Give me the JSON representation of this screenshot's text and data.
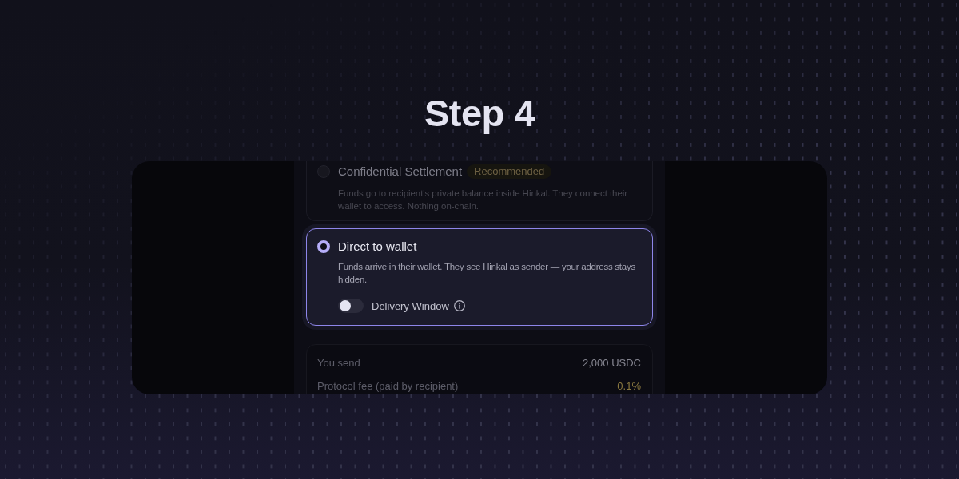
{
  "heading": "Step 4",
  "delivery_options": [
    {
      "title": "Confidential Settlement",
      "badge": "Recommended",
      "description": "Funds go to recipient's private balance inside Hinkal. They connect their wallet to access. Nothing on-chain.",
      "selected": false
    },
    {
      "title": "Direct to wallet",
      "description": "Funds arrive in their wallet. They see Hinkal as sender — your address stays hidden.",
      "selected": true,
      "toggle": {
        "label": "Delivery Window",
        "on": false
      }
    }
  ],
  "summary": {
    "rows": [
      {
        "label": "You send",
        "value": "2,000 USDC",
        "kind": "plain"
      },
      {
        "label": "Protocol fee (paid by recipient)",
        "value": "0.1%",
        "kind": "accent"
      }
    ]
  }
}
